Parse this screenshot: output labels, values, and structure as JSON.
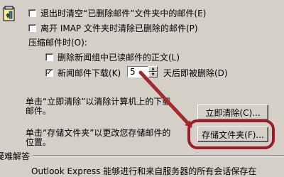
{
  "options": {
    "empty_deleted_on_exit": {
      "label": "退出时清空“已删除邮件”文件夹中的邮件(E)",
      "checked": false
    },
    "purge_on_leave_imap": {
      "label": "离开 IMAP 文件夹时清除已删除的邮件(P)",
      "checked": false
    }
  },
  "compact": {
    "group_label": "压缩邮件时(O):",
    "delete_read_news": {
      "label": "删除新闻组中已读邮件的正文(L)",
      "checked": false
    },
    "delete_downloaded_news": {
      "label_before": "新闻邮件下载(K)",
      "days_value": "5",
      "label_after": "天后即被删除(D)",
      "checked": true
    }
  },
  "clean_now": {
    "description_line1": "单击“立即清除”以清除计算机上的下载",
    "description_line2": "邮件。",
    "button_label": "立即清除(C)..."
  },
  "store_folder": {
    "description_line1": "单击“存储文件夹”以更改您存储邮件的",
    "description_line2": "位置。",
    "button_label": "存储文件夹(F)..."
  },
  "troubleshooting": {
    "heading": "疑难解答",
    "partial_text": "Outlook Express 能够进行和来自服务器的所有会话保存在"
  },
  "colors": {
    "highlight_ring": "#9c1d28",
    "arrow": "#a52a2a"
  }
}
